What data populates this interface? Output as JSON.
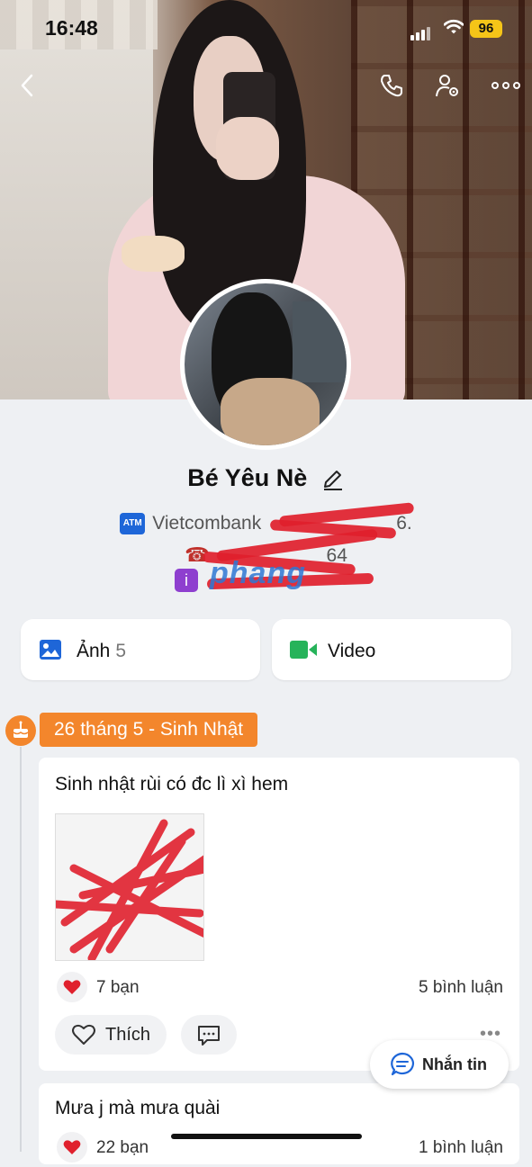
{
  "status_bar": {
    "time": "16:48",
    "battery": "96"
  },
  "profile": {
    "name": "Bé Yêu Nè",
    "bio_bank": "Vietcombank",
    "bio_bank_suffix": "6.",
    "bio_phone_suffix": "64",
    "watermark": "phang"
  },
  "tiles": [
    {
      "label": "Ảnh",
      "count": "5",
      "icon": "photo-icon"
    },
    {
      "label": "Video",
      "icon": "video-icon"
    }
  ],
  "timeline": {
    "date_badge": "26 tháng 5 - Sinh Nhật",
    "posts": [
      {
        "text": "Sinh nhật rùi có đc lì xì hem",
        "likes": "7 bạn",
        "comments": "5 bình luận",
        "like_label": "Thích"
      },
      {
        "text": "Mưa j mà mưa quài",
        "likes": "22 bạn",
        "comments": "1 bình luận"
      }
    ]
  },
  "message_button": {
    "label": "Nhắn tin"
  },
  "colors": {
    "accent": "#f3862c",
    "brand_blue": "#1e66d8",
    "heart": "#e0202d"
  }
}
